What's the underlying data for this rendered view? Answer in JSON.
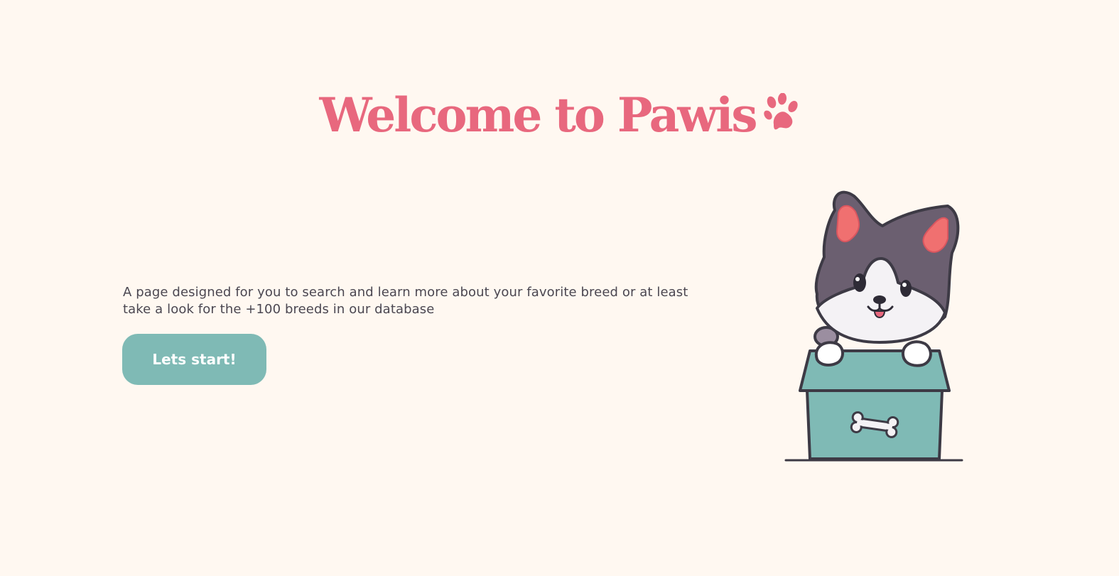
{
  "hero": {
    "title": "Welcome to Pawis",
    "title_icon": "paw-print-icon",
    "description": "A page designed for you to search and learn more about your favorite breed or at least take a look for the +100 breeds in our database",
    "cta_label": "Lets start!",
    "illustration": "corgi-in-box-illustration"
  },
  "colors": {
    "background": "#fff8f1",
    "accent": "#e8687e",
    "button": "#7fbab5",
    "text": "#4b4751"
  }
}
